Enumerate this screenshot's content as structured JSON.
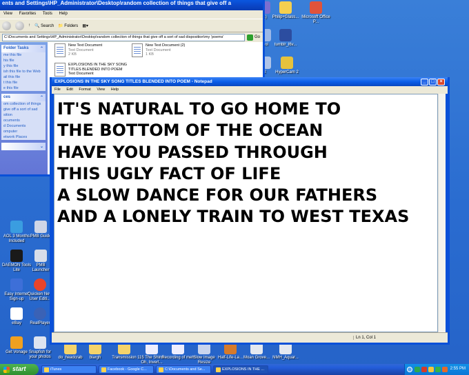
{
  "explorer": {
    "title": "ents and Settings\\HP_Administrator\\Desktop\\random collection of things that give off a",
    "menu": [
      "View",
      "Favorites",
      "Tools",
      "Help"
    ],
    "toolbar": {
      "search": "Search",
      "folders": "Folders"
    },
    "address": "C:\\Documents and Settings\\HP_Administrator\\Desktop\\random collection of things that give off a sort of sad disposition\\my 'poems'",
    "go_label": "Go",
    "taskpane": {
      "folder_tasks": {
        "title": "Folder Tasks",
        "items": [
          "me this file",
          "his file",
          "y this file",
          "ish this file to the Web",
          "ail this file",
          "t this file",
          "e this file"
        ]
      },
      "places": {
        "title": "ces",
        "items": [
          "om collection of things",
          "give off a sort of sad",
          "sition",
          "ocuments",
          "d Documents",
          "omputer",
          "etwork Places"
        ]
      }
    },
    "files": [
      {
        "name": "New Text Document",
        "type": "Text Document",
        "size": "2 KB"
      },
      {
        "name": "New Text Document (2)",
        "type": "Text Document",
        "size": "1 KB"
      },
      {
        "name": "EXPLOSIONS IN THE SKY SONG TITLES BLENDED INTO POEM",
        "type": "Text Document",
        "size": ""
      }
    ]
  },
  "notepad": {
    "title": "EXPLOSIONS IN THE SKY SONG TITLES BLENDED INTO POEM - Notepad",
    "menu": [
      "File",
      "Edit",
      "Format",
      "View",
      "Help"
    ],
    "lines": [
      "IT'S NATURAL TO GO HOME TO",
      "THE BOTTOM OF THE OCEAN",
      "HAVE YOU PASSED THROUGH",
      "THIS UGLY FACT OF LIFE",
      "A SLOW DANCE FOR OUR FATHERS",
      "AND A LONELY TRAIN TO WEST TEXAS"
    ],
    "status": "Ln 1, Col 1"
  },
  "desktop_icons_right": [
    {
      "label": "(1)",
      "icon": "photo-icon"
    },
    {
      "label": "Philip+Glass...",
      "icon": "music-folder-icon"
    },
    {
      "label": "Microsoft Office P...",
      "icon": "office-icon"
    },
    {
      "label": "mol",
      "icon": "app-icon"
    },
    {
      "label": "tumblr_l6v...",
      "icon": "image-icon"
    },
    {
      "label": "2",
      "icon": "app-icon"
    },
    {
      "label": "HyperCam 2",
      "icon": "hypercam-icon"
    }
  ],
  "desktop_icons_left": [
    {
      "label": "AOL 3 Months Included",
      "icon": "aol-icon"
    },
    {
      "label": "PMB Guide",
      "icon": "pmb-guide-icon"
    },
    {
      "label": "DAEMON Tools Lite",
      "icon": "daemon-tools-icon"
    },
    {
      "label": "PMB Launcher",
      "icon": "pmb-launcher-icon"
    },
    {
      "label": "Easy Internet Sign-up",
      "icon": "easy-internet-icon"
    },
    {
      "label": "Quicken New User Editi...",
      "icon": "quicken-icon"
    },
    {
      "label": "eBay",
      "icon": "ebay-icon"
    },
    {
      "label": "RealPlayer",
      "icon": "realplayer-icon"
    },
    {
      "label": "Get Vonage",
      "icon": "vonage-icon"
    },
    {
      "label": "Snapfish for your photos",
      "icon": "snapfish-icon"
    }
  ],
  "desktop_icons_bottom": [
    {
      "label": "do_headcrab",
      "icon": "folder-icon"
    },
    {
      "label": "blargh",
      "icon": "folder-icon"
    },
    {
      "label": "Transmission",
      "icon": "folder-icon"
    },
    {
      "label": "115 The Shins - Oh, Invert...",
      "icon": "audio-file-icon"
    },
    {
      "label": "Recording of meh",
      "icon": "audio-file-icon"
    },
    {
      "label": "Slow Image Resize",
      "icon": "app-icon"
    },
    {
      "label": "Half-Life-La...",
      "icon": "game-icon"
    },
    {
      "label": "Moan Grove...",
      "icon": "file-icon"
    },
    {
      "label": "NMH_Aquar...",
      "icon": "file-icon"
    }
  ],
  "taskbar": {
    "start": "start",
    "buttons": [
      {
        "label": "iTunes",
        "active": false
      },
      {
        "label": "Facebook - Google C...",
        "active": false
      },
      {
        "label": "C:\\Documents and Se...",
        "active": false
      },
      {
        "label": "EXPLOSIONS IN THE ...",
        "active": true
      }
    ],
    "clock": "2:55 PM"
  },
  "colors": {
    "desktop": "#2a6cd0",
    "titlebar": "#0a5ee8",
    "taskbar": "#245edb",
    "start": "#3c9a3c",
    "tray": "#0f86e0"
  }
}
